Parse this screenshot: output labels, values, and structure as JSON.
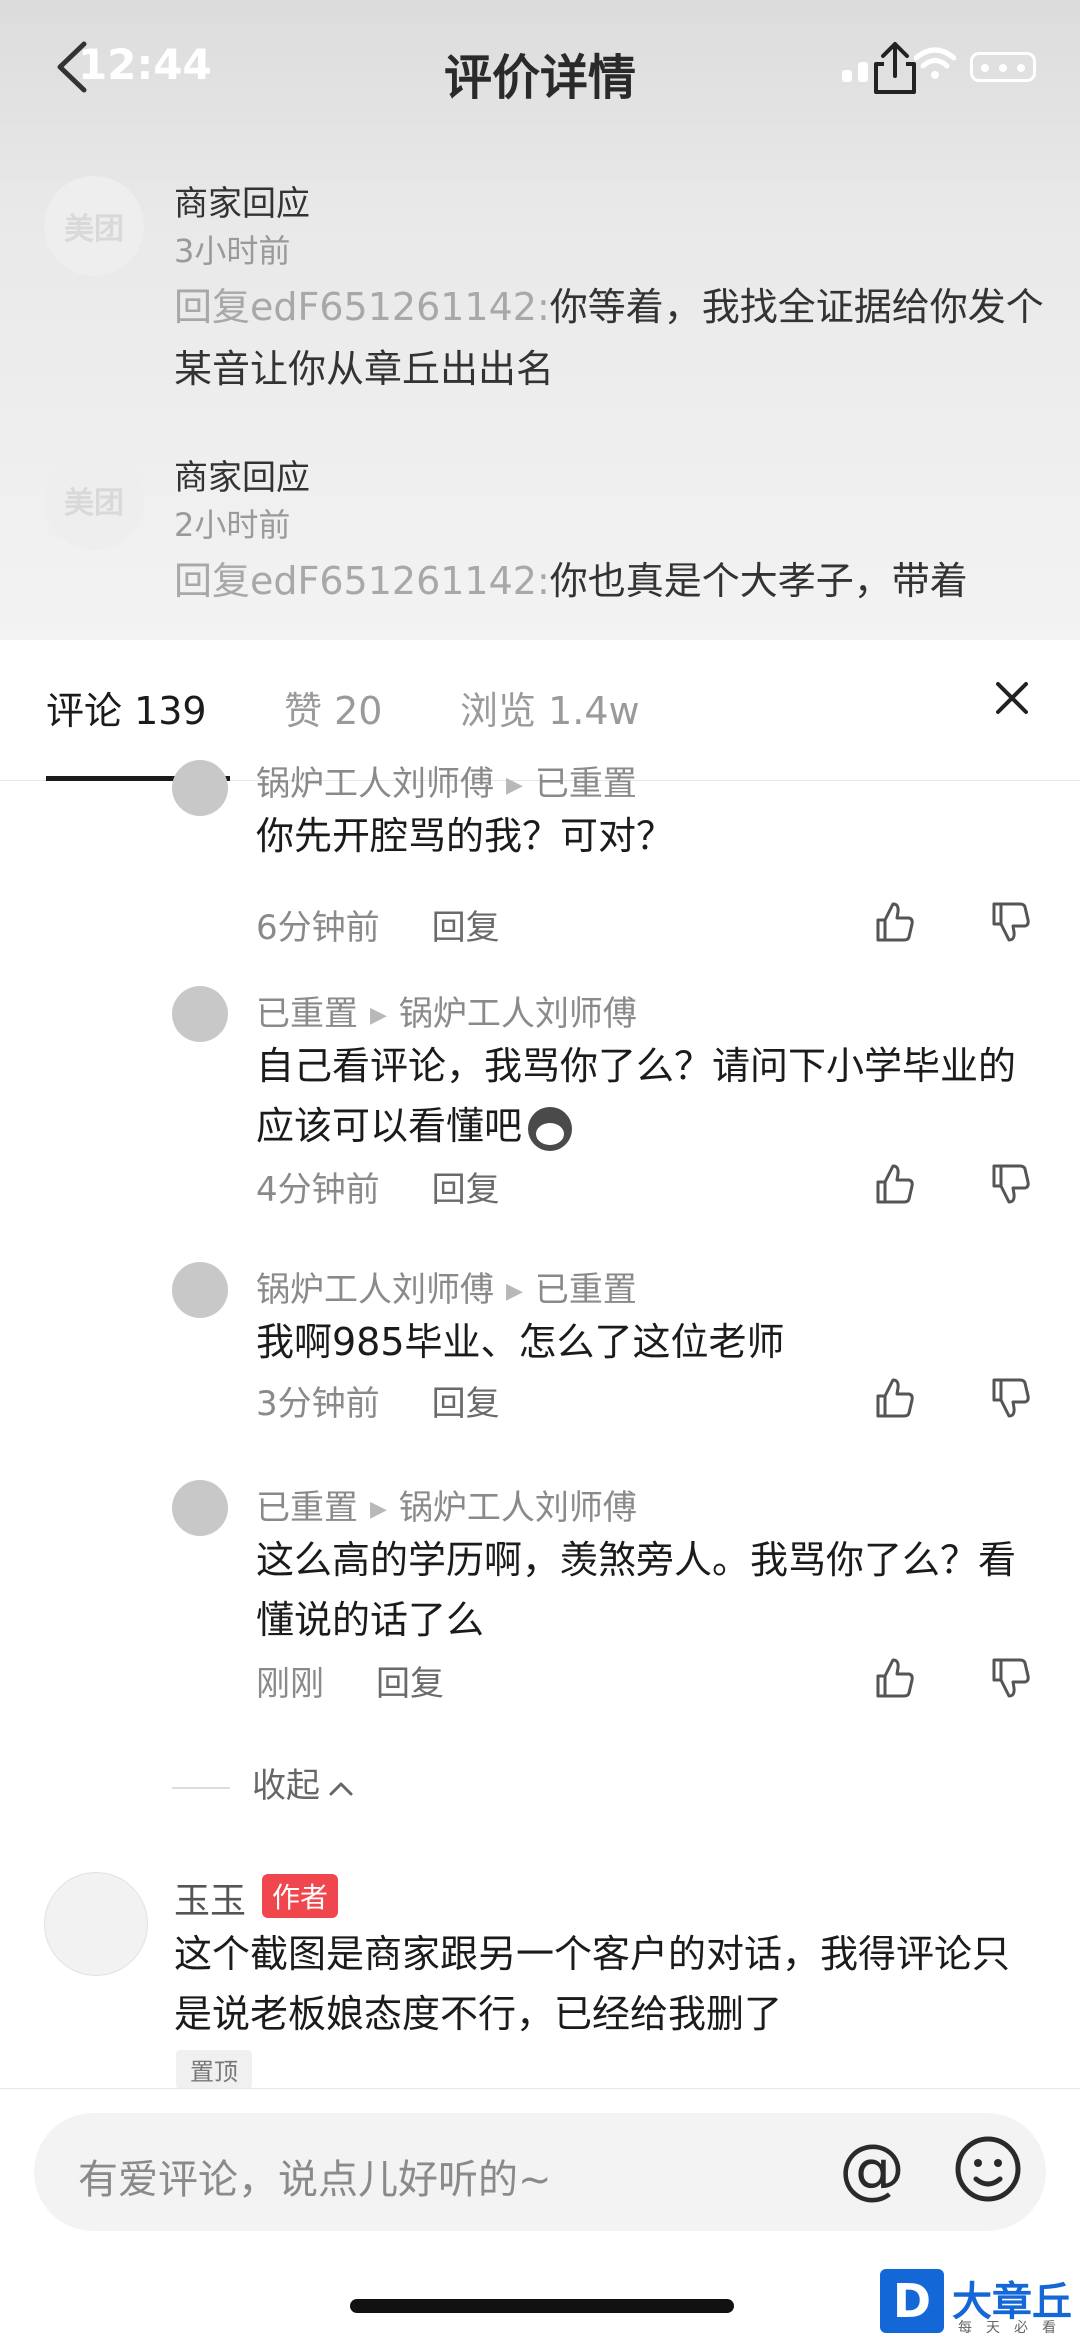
{
  "status_bar": {
    "time": "12:44"
  },
  "header": {
    "title": "评价详情"
  },
  "merchant_replies": [
    {
      "avatar_text": "美团",
      "name": "商家回应",
      "time": "3小时前",
      "prefix": "回复edF651261142:",
      "text": "你等着，我找全证据给你发个某音让你从章丘出出名"
    },
    {
      "avatar_text": "美团",
      "name": "商家回应",
      "time": "2小时前",
      "prefix": "回复edF651261142:",
      "text": "你也真是个大孝子，带着"
    }
  ],
  "tabs": [
    {
      "label": "评论 139"
    },
    {
      "label": "赞 20"
    },
    {
      "label": "浏览 1.4w"
    }
  ],
  "replies": [
    {
      "from": "锅炉工人刘师傅",
      "to": "已重置",
      "text": "你先开腔骂的我？可对？",
      "time": "6分钟前",
      "reply_label": "回复"
    },
    {
      "from": "已重置",
      "to": "锅炉工人刘师傅",
      "text": "自己看评论，我骂你了么？请问下小学毕业的应该可以看懂吧",
      "time": "4分钟前",
      "reply_label": "回复"
    },
    {
      "from": "锅炉工人刘师傅",
      "to": "已重置",
      "text": "我啊985毕业、怎么了这位老师",
      "time": "3分钟前",
      "reply_label": "回复"
    },
    {
      "from": "已重置",
      "to": "锅炉工人刘师傅",
      "text": "这么高的学历啊，羡煞旁人。我骂你了么？看懂说的话了么",
      "time": "刚刚",
      "reply_label": "回复"
    }
  ],
  "collapse_label": "收起",
  "comment": {
    "name": "玉玉",
    "badge": "作者",
    "text": "这个截图是商家跟另一个客户的对话，我得评论只是说老板娘态度不行，已经给我删了",
    "pin": "置顶"
  },
  "input": {
    "placeholder": "有爱评论，说点儿好听的~",
    "at": "@"
  },
  "watermark": {
    "letter": "D",
    "name": "大章丘",
    "slogan": "每天必看"
  }
}
